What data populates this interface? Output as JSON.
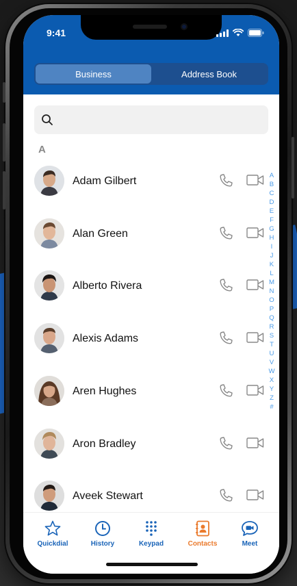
{
  "status_bar": {
    "time": "9:41"
  },
  "segment": {
    "tabs": [
      {
        "label": "Business",
        "active": true
      },
      {
        "label": "Address Book",
        "active": false
      }
    ]
  },
  "search": {
    "placeholder": ""
  },
  "section_letter": "A",
  "contacts": [
    {
      "name": "Adam Gilbert"
    },
    {
      "name": "Alan Green"
    },
    {
      "name": "Alberto Rivera"
    },
    {
      "name": "Alexis Adams"
    },
    {
      "name": "Aren Hughes"
    },
    {
      "name": "Aron Bradley"
    },
    {
      "name": "Aveek Stewart"
    }
  ],
  "alphabet_index": [
    "A",
    "B",
    "C",
    "D",
    "E",
    "F",
    "G",
    "H",
    "I",
    "J",
    "K",
    "L",
    "M",
    "N",
    "O",
    "P",
    "Q",
    "R",
    "S",
    "T",
    "U",
    "V",
    "W",
    "X",
    "Y",
    "Z",
    "#"
  ],
  "tabbar": {
    "items": [
      {
        "label": "Quickdial",
        "icon": "star-icon"
      },
      {
        "label": "History",
        "icon": "clock-icon"
      },
      {
        "label": "Keypad",
        "icon": "keypad-icon"
      },
      {
        "label": "Contacts",
        "icon": "contacts-icon",
        "active": true
      },
      {
        "label": "Meet",
        "icon": "meet-icon"
      }
    ]
  },
  "colors": {
    "header": "#0b5bb0",
    "accent": "#1a64b8",
    "active_tab": "#ea7a2c",
    "index": "#4a9be8"
  }
}
